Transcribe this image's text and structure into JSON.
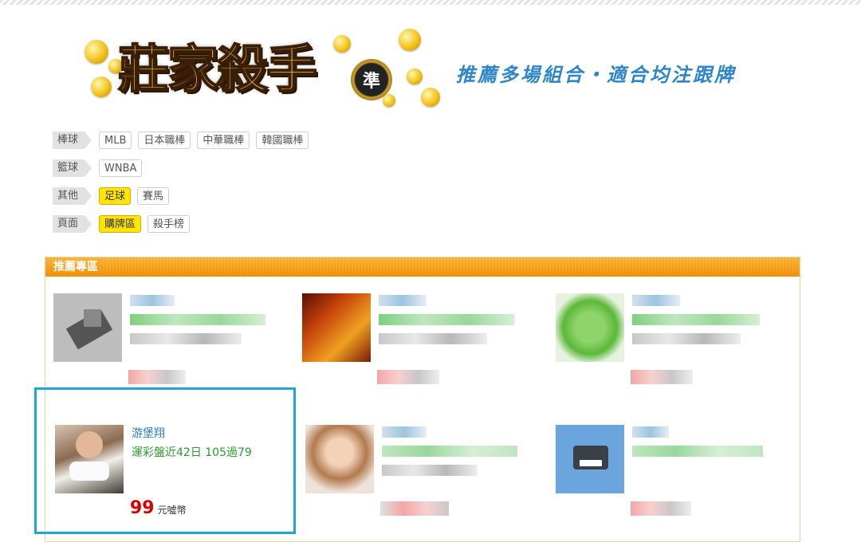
{
  "logo": {
    "title": "莊家殺手",
    "badge": "準"
  },
  "slogan": "推薦多場組合・適合均注跟牌",
  "nav": [
    {
      "label": "棒球",
      "items": [
        {
          "text": "MLB",
          "active": false
        },
        {
          "text": "日本職棒",
          "active": false
        },
        {
          "text": "中華職棒",
          "active": false
        },
        {
          "text": "韓國職棒",
          "active": false
        }
      ]
    },
    {
      "label": "籃球",
      "items": [
        {
          "text": "WNBA",
          "active": false
        }
      ]
    },
    {
      "label": "其他",
      "items": [
        {
          "text": "足球",
          "active": true
        },
        {
          "text": "賽馬",
          "active": false
        }
      ]
    },
    {
      "label": "頁面",
      "items": [
        {
          "text": "購牌區",
          "active": true
        },
        {
          "text": "殺手榜",
          "active": false
        }
      ]
    }
  ],
  "panel": {
    "title": "推薦專區"
  },
  "featured": {
    "name": "游堡翔",
    "stat": "運彩盤近42日 105過79",
    "price": "99",
    "unit": "元噓幣"
  },
  "colors": {
    "accent": "#ee8c00",
    "highlight": "#1fa6d3",
    "active_nav": "#ffe600",
    "price": "#d40000",
    "name": "#2b7fc0",
    "stat": "#2f9a2f"
  }
}
